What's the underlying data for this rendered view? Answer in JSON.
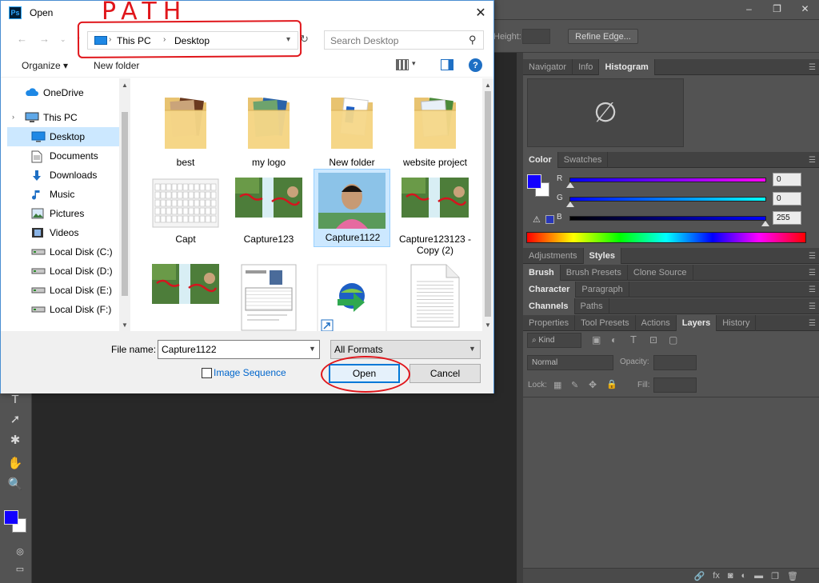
{
  "annotations": {
    "path_text": "PATH"
  },
  "photoshop": {
    "window_buttons": [
      "–",
      "❐",
      "✕"
    ],
    "options_bar": {
      "height_label": "Height:",
      "refine_edge": "Refine Edge..."
    },
    "panel_groups": {
      "navigator": {
        "tabs": [
          "Navigator",
          "Info",
          "Histogram"
        ],
        "active": "Histogram",
        "empty_symbol": "∅"
      },
      "color": {
        "tabs": [
          "Color",
          "Swatches"
        ],
        "active": "Color",
        "channels": [
          {
            "label": "R",
            "value": "0"
          },
          {
            "label": "G",
            "value": "0"
          },
          {
            "label": "B",
            "value": "255"
          }
        ],
        "foreground": "#1200ff",
        "background": "#ffffff"
      },
      "adjustments": {
        "tabs": [
          "Adjustments",
          "Styles"
        ],
        "active": "Styles"
      },
      "brush": {
        "tabs": [
          "Brush",
          "Brush Presets",
          "Clone Source"
        ],
        "active": "Brush"
      },
      "character": {
        "tabs": [
          "Character",
          "Paragraph"
        ],
        "active": "Character"
      },
      "channels": {
        "tabs": [
          "Channels",
          "Paths"
        ],
        "active": "Channels"
      },
      "layers": {
        "tabs": [
          "Properties",
          "Tool Presets",
          "Actions",
          "Layers",
          "History"
        ],
        "active": "Layers",
        "kind_label": "Kind",
        "blend_mode": "Normal",
        "opacity_label": "Opacity:",
        "lock_label": "Lock:",
        "fill_label": "Fill:",
        "footer_icons": [
          "🔗",
          "fx",
          "◙",
          "◐",
          "▬",
          "❐",
          "🗑"
        ]
      }
    }
  },
  "dialog": {
    "title": "Open",
    "app_icon": "Ps",
    "address": {
      "segments": [
        "This PC",
        "Desktop"
      ]
    },
    "search_placeholder": "Search Desktop",
    "toolbar": {
      "organize": "Organize ▾",
      "new_folder": "New folder",
      "help": "?"
    },
    "nav_items": [
      {
        "label": "OneDrive",
        "icon": "cloud-icon"
      },
      {
        "label": "This PC",
        "icon": "computer-icon"
      },
      {
        "label": "Desktop",
        "icon": "desktop-icon",
        "selected": true
      },
      {
        "label": "Documents",
        "icon": "documents-icon"
      },
      {
        "label": "Downloads",
        "icon": "downloads-icon"
      },
      {
        "label": "Music",
        "icon": "music-icon"
      },
      {
        "label": "Pictures",
        "icon": "pictures-icon"
      },
      {
        "label": "Videos",
        "icon": "videos-icon"
      },
      {
        "label": "Local Disk (C:)",
        "icon": "drive-icon"
      },
      {
        "label": "Local Disk (D:)",
        "icon": "drive-icon"
      },
      {
        "label": "Local Disk (E:)",
        "icon": "drive-icon"
      },
      {
        "label": "Local Disk (F:)",
        "icon": "drive-icon"
      }
    ],
    "files": [
      {
        "label": "best",
        "type": "folder"
      },
      {
        "label": "my logo",
        "type": "folder"
      },
      {
        "label": "New folder",
        "type": "folder"
      },
      {
        "label": "website project",
        "type": "folder"
      },
      {
        "label": "Capt",
        "type": "image-keyboard"
      },
      {
        "label": "Capture123",
        "type": "image-waterfall"
      },
      {
        "label": "Capture1122",
        "type": "image-portrait",
        "selected": true
      },
      {
        "label": "Capture123123 - Copy (2)",
        "type": "image-waterfall"
      },
      {
        "label": "",
        "type": "image-waterfall"
      },
      {
        "label": "",
        "type": "image-document"
      },
      {
        "label": "",
        "type": "idm-shortcut"
      },
      {
        "label": "",
        "type": "text-file"
      }
    ],
    "file_name_label": "File name:",
    "file_name_value": "Capture1122",
    "format_value": "All Formats",
    "image_sequence_label": "Image Sequence",
    "open_label": "Open",
    "cancel_label": "Cancel"
  }
}
